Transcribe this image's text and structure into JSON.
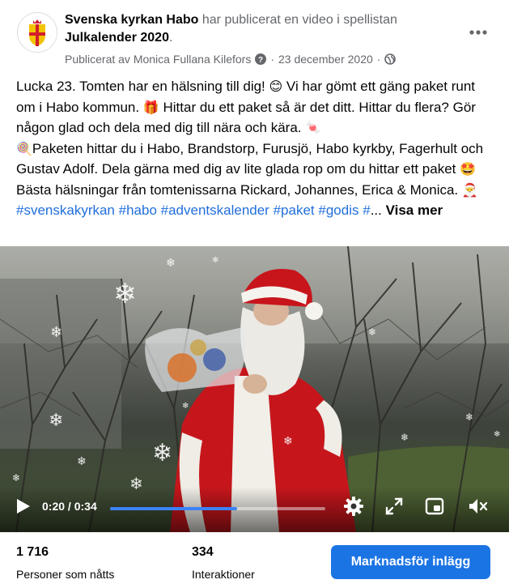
{
  "header": {
    "page_name": "Svenska kyrkan Habo",
    "action_text": " har publicerat en video i spellistan",
    "playlist_name": "Julkalender 2020",
    "playlist_suffix": ".",
    "published_by": "Publicerat av Monica Fullana Kilefors",
    "separator": "·",
    "date": "23 december 2020",
    "separator2": "·",
    "help_icon": "question-circle-icon",
    "audience_icon": "globe-icon",
    "more_icon": "more-dots-icon"
  },
  "post": {
    "seg1": "Lucka 23. Tomten har en hälsning till dig! ",
    "emoji1": "😊",
    "seg2": " Vi har gömt ett gäng paket runt om i Habo kommun. ",
    "emoji2": "🎁",
    "seg3": " Hittar du ett paket så är det ditt. Hittar du flera? Gör någon glad och dela med dig till nära och kära. ",
    "emoji3": "🍬",
    "emoji4": "🍭",
    "seg4": "Paketen hittar du i Habo, Brandstorp, Furusjö, Habo kyrkby, Fagerhult och Gustav Adolf. Dela gärna med dig av lite glada rop om du hittar ett paket ",
    "emoji5": "🤩",
    "seg5": "Bästa hälsningar från tomtenissarna Rickard, Johannes, Erica & Monica. ",
    "emoji6": "🎅",
    "hashtag1": "#svenskakyrkan",
    "hashtag2": "#habo",
    "hashtag3": "#adventskalender",
    "hashtag4": "#paket",
    "hashtag5": "#godis",
    "hashtag6": "#",
    "ellipsis": "...",
    "see_more": "Visa mer"
  },
  "video": {
    "current_time": "0:20",
    "time_separator": "/",
    "duration": "0:34",
    "progress_fraction": 0.59,
    "controls": [
      "play-icon",
      "settings-gear-icon",
      "fullscreen-icon",
      "picture-in-picture-icon",
      "volume-muted-icon"
    ],
    "accent": "#3b82f6"
  },
  "stats": {
    "reached_value": "1 716",
    "reached_label": "Personer som nåtts",
    "interactions_value": "334",
    "interactions_label": "Interaktioner"
  },
  "actions": {
    "promote_label": "Marknadsför inlägg",
    "promote_color": "#1b74e4"
  }
}
